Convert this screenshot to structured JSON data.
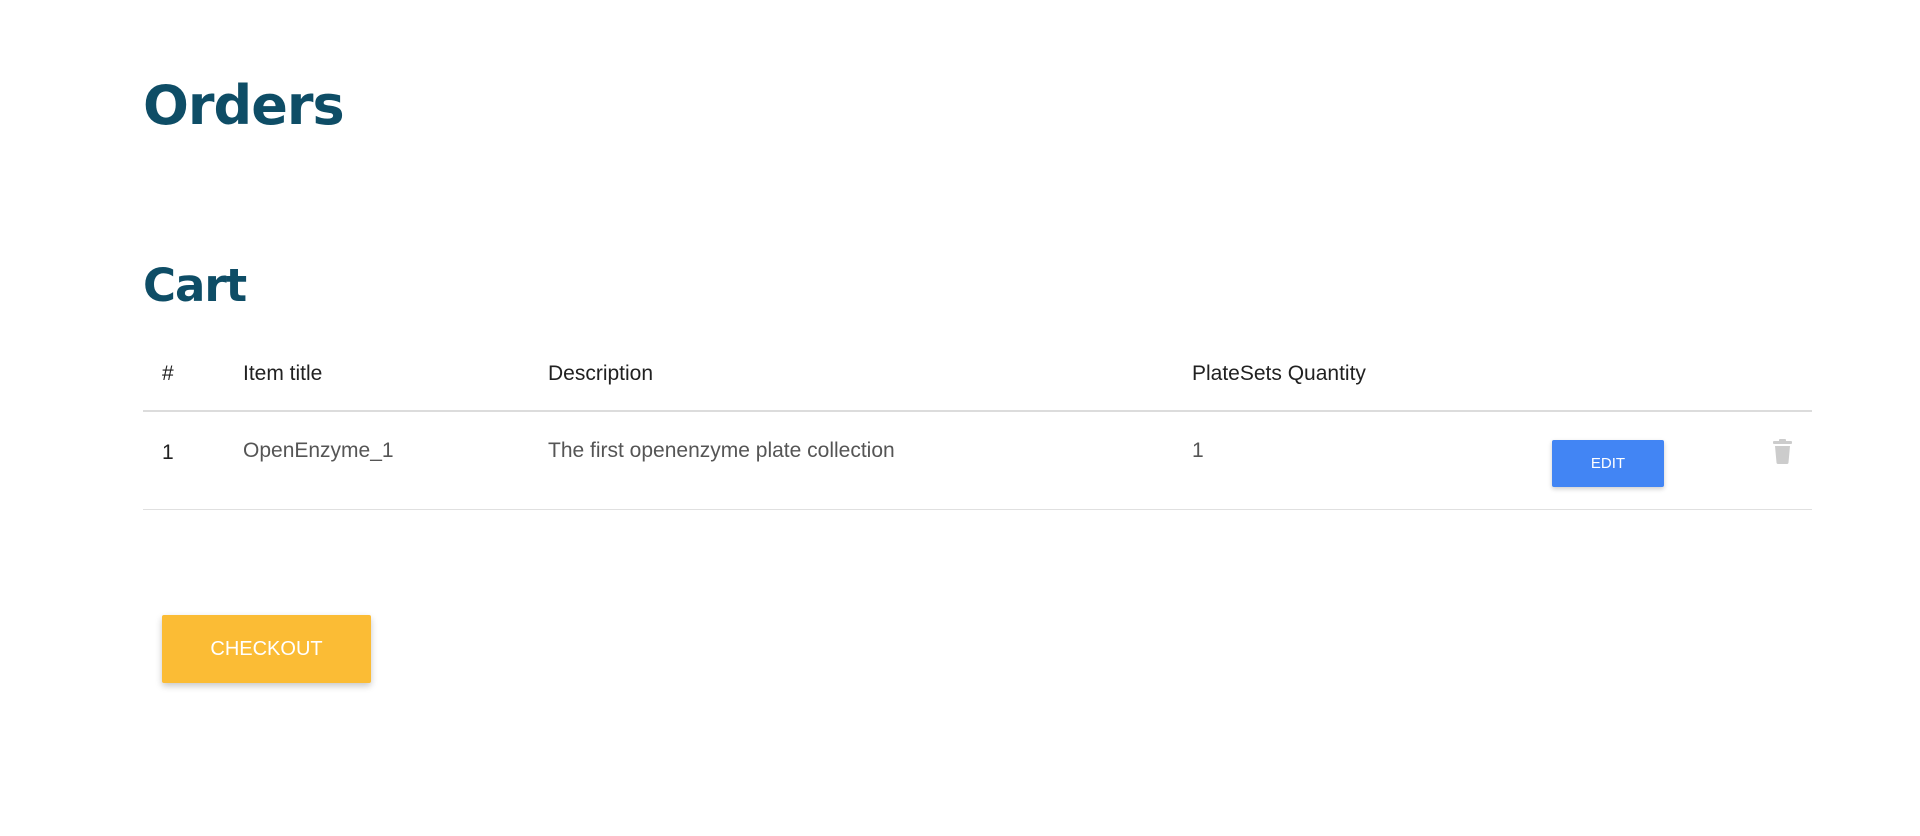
{
  "page": {
    "title": "Orders"
  },
  "cart": {
    "title": "Cart",
    "columns": [
      "#",
      "Item title",
      "Description",
      "PlateSets Quantity"
    ],
    "rows": [
      {
        "number": "1",
        "item_title": "OpenEnzyme_1",
        "description": "The first openenzyme plate collection",
        "quantity": "1",
        "edit_label": "EDIT",
        "delete_icon": "trash-icon"
      }
    ]
  },
  "checkout": {
    "label": "CHECKOUT"
  },
  "colors": {
    "heading": "#0e4d66",
    "edit_button": "#4285f4",
    "checkout_button": "#fbbc35",
    "trash_icon": "#cccccc"
  }
}
